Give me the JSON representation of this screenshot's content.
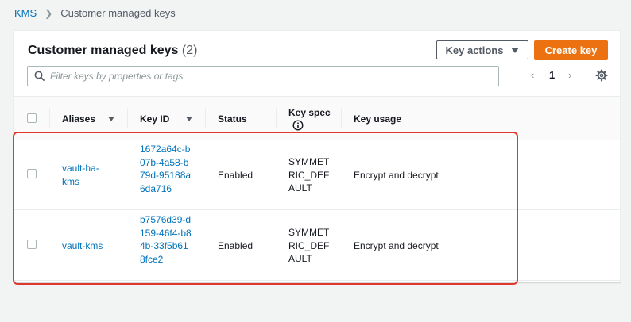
{
  "breadcrumb": {
    "root": "KMS",
    "current": "Customer managed keys"
  },
  "panel": {
    "title": "Customer managed keys",
    "count": "(2)",
    "key_actions_label": "Key actions",
    "create_key_label": "Create key",
    "search_placeholder": "Filter keys by properties or tags",
    "pagination": {
      "prev": "‹",
      "page": "1",
      "next": "›"
    }
  },
  "table": {
    "columns": {
      "aliases": "Aliases",
      "key_id": "Key ID",
      "status": "Status",
      "key_spec": "Key spec",
      "key_usage": "Key usage"
    },
    "rows": [
      {
        "alias": "vault-ha-kms",
        "key_id": "1672a64c-b07b-4a58-b79d-95188a6da716",
        "status": "Enabled",
        "key_spec": "SYMMETRIC_DEFAULT",
        "key_usage": "Encrypt and decrypt"
      },
      {
        "alias": "vault-kms",
        "key_id": "b7576d39-d159-46f4-b84b-33f5b618fce2",
        "status": "Enabled",
        "key_spec": "SYMMETRIC_DEFAULT",
        "key_usage": "Encrypt and decrypt"
      }
    ]
  },
  "colors": {
    "link": "#0073bb",
    "primary_button": "#ec7211",
    "highlight": "#e0382d"
  }
}
